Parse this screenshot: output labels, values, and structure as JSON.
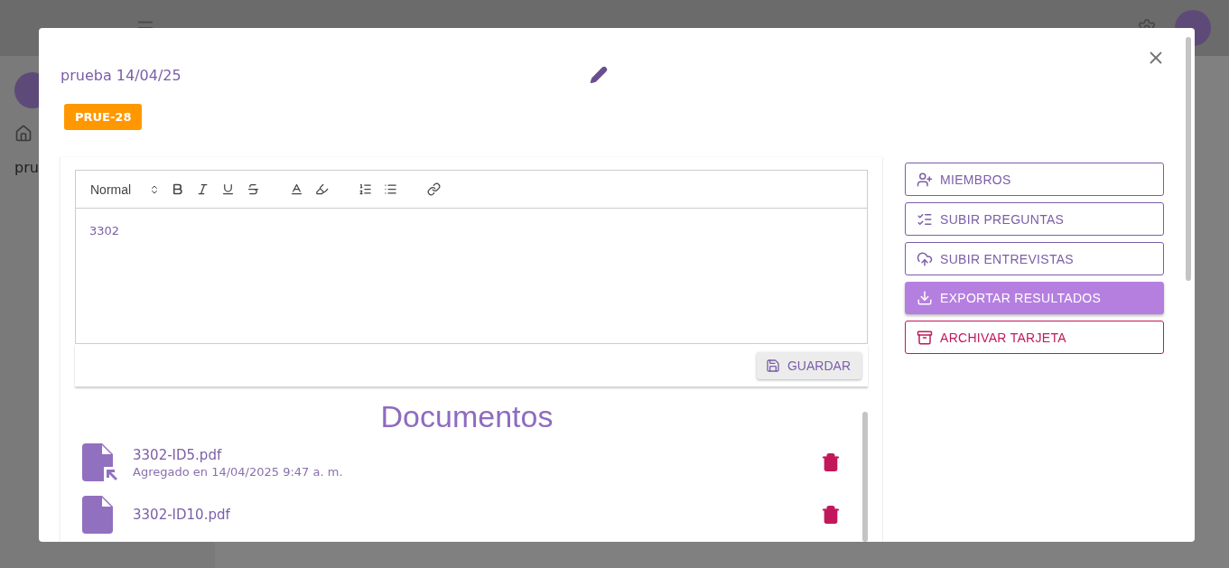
{
  "background": {
    "sidebar": {
      "items": [
        "pru"
      ]
    }
  },
  "card": {
    "title": "prueba 14/04/25",
    "code": "PRUE-28",
    "editor": {
      "format": "Normal",
      "content": "3302",
      "save": "GUARDAR"
    },
    "documents": {
      "heading": "Documentos",
      "files": [
        {
          "name": "3302-ID5.pdf",
          "added": "Agregado en 14/04/2025 9:47 a. m."
        },
        {
          "name": "3302-ID10.pdf"
        }
      ]
    },
    "actions": [
      {
        "label": "MIEMBROS",
        "kind": "outlined"
      },
      {
        "label": "SUBIR PREGUNTAS",
        "kind": "outlined"
      },
      {
        "label": "SUBIR ENTREVISTAS",
        "kind": "outlined"
      },
      {
        "label": "EXPORTAR RESULTADOS",
        "kind": "filled"
      },
      {
        "label": "ARCHIVAR TARJETA",
        "kind": "danger"
      }
    ]
  }
}
